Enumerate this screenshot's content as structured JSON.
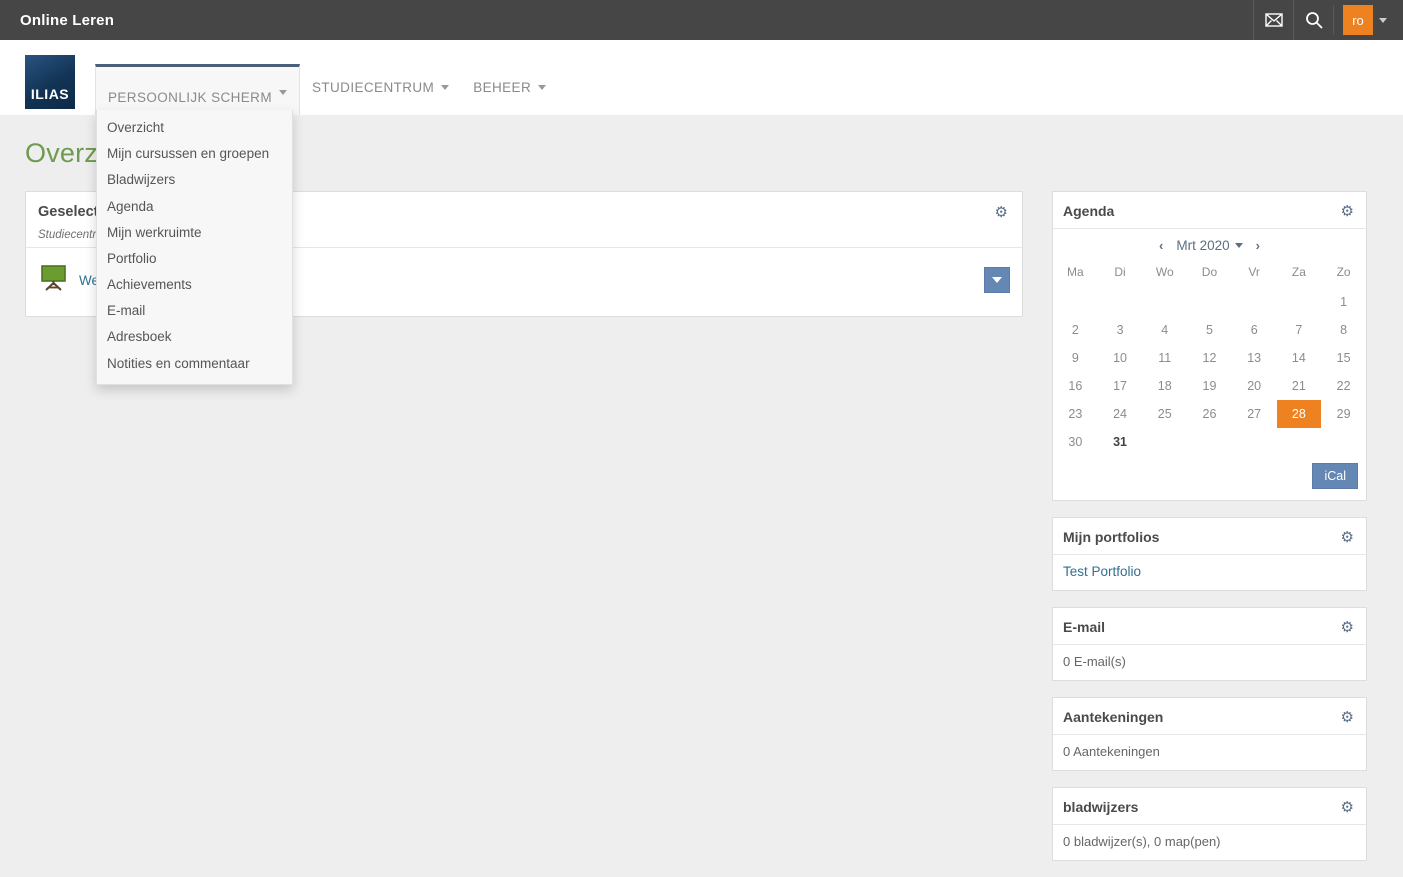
{
  "topbar": {
    "title": "Online Leren",
    "mail_icon": "envelope-icon",
    "search_icon": "search-icon",
    "avatar_initials": "ro"
  },
  "brand": {
    "logo_text": "ILIAS"
  },
  "nav": {
    "items": [
      {
        "label": "PERSOONLIJK SCHERM",
        "active": true
      },
      {
        "label": "STUDIECENTRUM",
        "active": false
      },
      {
        "label": "BEHEER",
        "active": false
      }
    ]
  },
  "dropdown": {
    "open": true,
    "items": [
      "Overzicht",
      "Mijn cursussen en groepen",
      "Bladwijzers",
      "Agenda",
      "Mijn werkruimte",
      "Portfolio",
      "Achievements",
      "E-mail",
      "Adresboek",
      "Notities en commentaar"
    ]
  },
  "page": {
    "title": "Overzicht"
  },
  "main_panel": {
    "title": "Geselecteerde items",
    "subtitle": "Studiecentrum",
    "row": {
      "icon": "course-easel-icon",
      "link": "Welkom",
      "actions_label": "actions-dropdown"
    }
  },
  "calendar": {
    "title": "Agenda",
    "prev_label": "‹",
    "next_label": "›",
    "month_label": "Mrt 2020",
    "weekdays": [
      "Ma",
      "Di",
      "Wo",
      "Do",
      "Vr",
      "Za",
      "Zo"
    ],
    "weeks": [
      [
        {
          "d": ""
        },
        {
          "d": ""
        },
        {
          "d": ""
        },
        {
          "d": ""
        },
        {
          "d": ""
        },
        {
          "d": ""
        },
        {
          "d": "1"
        }
      ],
      [
        {
          "d": "2"
        },
        {
          "d": "3"
        },
        {
          "d": "4"
        },
        {
          "d": "5"
        },
        {
          "d": "6"
        },
        {
          "d": "7"
        },
        {
          "d": "8"
        }
      ],
      [
        {
          "d": "9"
        },
        {
          "d": "10"
        },
        {
          "d": "11"
        },
        {
          "d": "12"
        },
        {
          "d": "13"
        },
        {
          "d": "14"
        },
        {
          "d": "15"
        }
      ],
      [
        {
          "d": "16"
        },
        {
          "d": "17"
        },
        {
          "d": "18"
        },
        {
          "d": "19"
        },
        {
          "d": "20"
        },
        {
          "d": "21"
        },
        {
          "d": "22"
        }
      ],
      [
        {
          "d": "23"
        },
        {
          "d": "24"
        },
        {
          "d": "25"
        },
        {
          "d": "26"
        },
        {
          "d": "27"
        },
        {
          "d": "28",
          "today": true
        },
        {
          "d": "29"
        }
      ],
      [
        {
          "d": "30"
        },
        {
          "d": "31",
          "bold": true
        },
        {
          "d": ""
        },
        {
          "d": ""
        },
        {
          "d": ""
        },
        {
          "d": ""
        },
        {
          "d": ""
        }
      ]
    ],
    "ical_label": "iCal"
  },
  "blocks": [
    {
      "title": "Mijn portfolios",
      "body": "Test Portfolio",
      "is_link": true
    },
    {
      "title": "E-mail",
      "body": "0 E-mail(s)",
      "is_link": false
    },
    {
      "title": "Aantekeningen",
      "body": "0 Aantekeningen",
      "is_link": false
    },
    {
      "title": "bladwijzers",
      "body": "0 bladwijzer(s), 0 map(pen)",
      "is_link": false
    }
  ],
  "colors": {
    "topbar": "#464646",
    "accent_orange": "#ef8220",
    "title_green": "#6e9b4e",
    "link_blue": "#31708f",
    "button_blue": "#6587b3",
    "logo_navy": "#123355"
  }
}
